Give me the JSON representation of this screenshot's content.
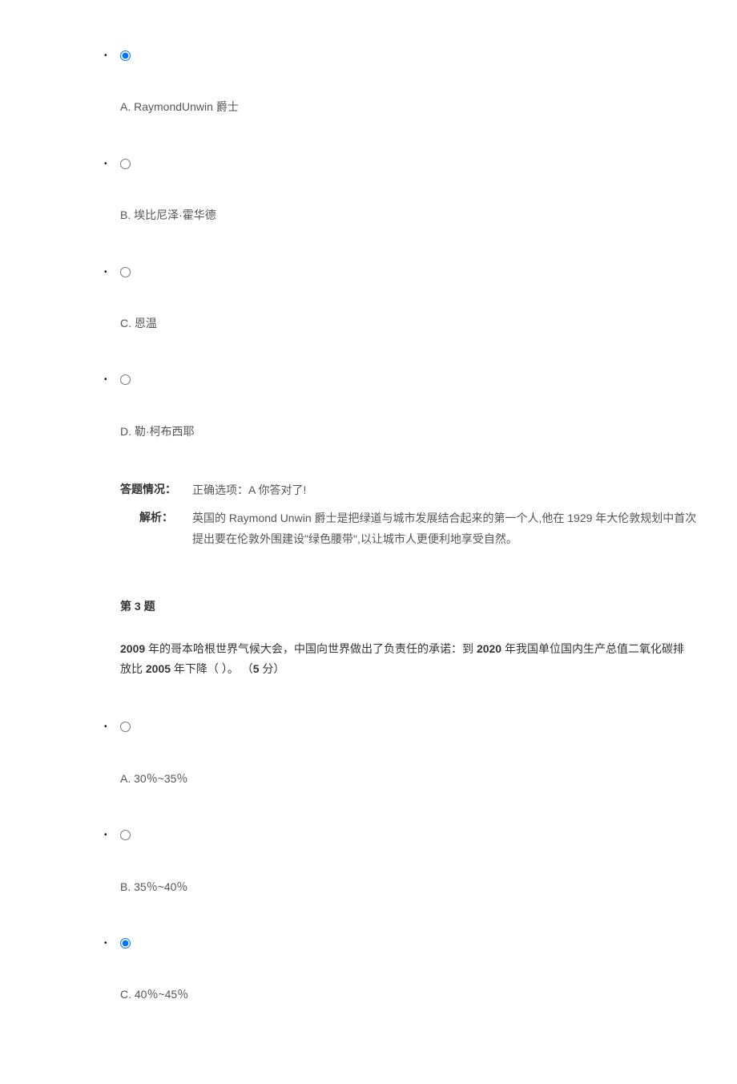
{
  "question2": {
    "options": [
      {
        "label": "A. RaymondUnwin 爵士",
        "selected": true
      },
      {
        "label": "B. 埃比尼泽·霍华德",
        "selected": false
      },
      {
        "label": "C. 恩温",
        "selected": false
      },
      {
        "label": "D. 勒·柯布西耶",
        "selected": false
      }
    ],
    "answer_label": "答题情况：",
    "answer_text": "正确选项：A  你答对了!",
    "analysis_label": "解析：",
    "analysis_text": "英国的 Raymond Unwin 爵士是把绿道与城市发展结合起来的第一个人,他在 1929 年大伦敦规划中首次提出要在伦敦外围建设\"绿色腰带\",以让城市人更便利地享受自然。"
  },
  "question3": {
    "header_prefix": "第 ",
    "header_num": "3",
    "header_suffix": " 题",
    "text_part1": "2009",
    "text_part2": " 年的哥本哈根世界气候大会，中国向世界做出了负责任的承诺：到 ",
    "text_part3": "2020",
    "text_part4": " 年我国单位国内生产总值二氧化碳排放比 ",
    "text_part5": "2005",
    "text_part6": " 年下降（   ）。    （",
    "text_part7": "5",
    "text_part8": " 分）",
    "options": [
      {
        "label": "A. 30％~35％",
        "selected": false
      },
      {
        "label": "B. 35％~40％",
        "selected": false
      },
      {
        "label": "C. 40％~45％",
        "selected": true
      }
    ]
  }
}
